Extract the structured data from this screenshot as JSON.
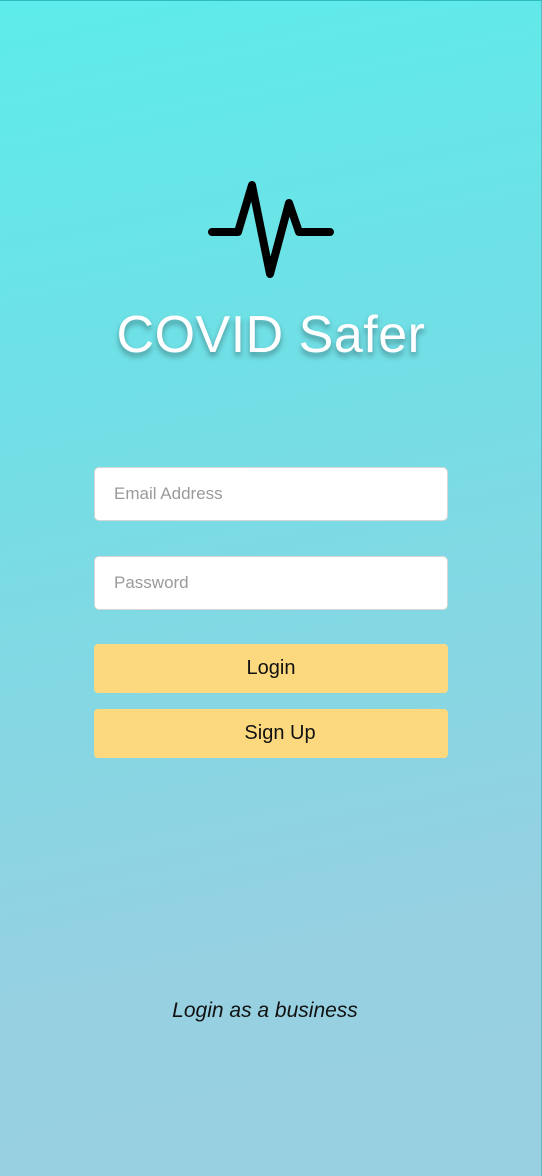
{
  "app": {
    "title": "COVID Safer",
    "logo_icon": "heartbeat-pulse-icon"
  },
  "form": {
    "email_placeholder": "Email Address",
    "email_value": "",
    "password_placeholder": "Password",
    "password_value": "",
    "login_label": "Login",
    "signup_label": "Sign Up"
  },
  "footer": {
    "business_link": "Login as a business"
  },
  "colors": {
    "gradient_top": "#5decea",
    "gradient_bottom": "#98d0e1",
    "button": "#fcd97f",
    "title": "#ffffff"
  }
}
